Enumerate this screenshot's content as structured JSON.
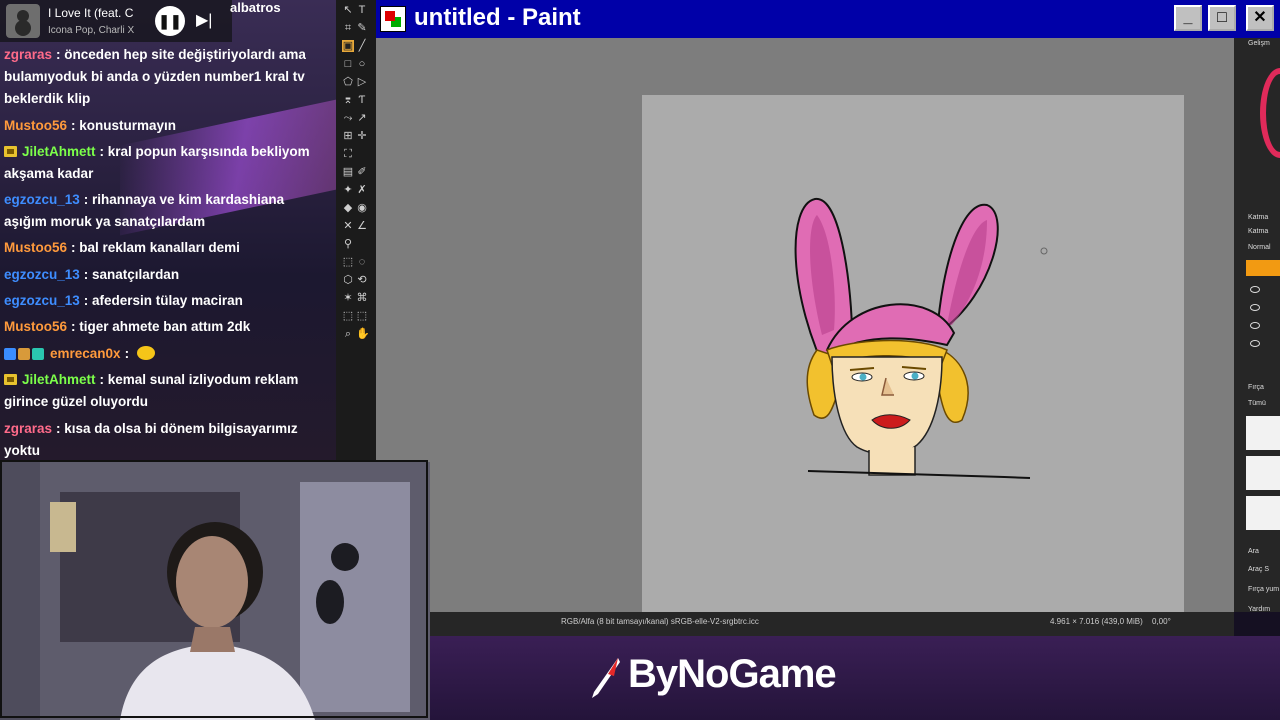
{
  "music": {
    "title": "I Love It (feat. C",
    "artist": "Icona Pop, Charli X",
    "pause_glyph": "❚❚",
    "next_glyph": "▶|"
  },
  "top_user": "albatros",
  "chat": [
    {
      "user": "zgraras",
      "color": "#ff6b8a",
      "text": ": önceden hep site değiştiriyolardı ama bulamıyoduk bi anda o yüzden number1 kral tv beklerdik klip"
    },
    {
      "user": "Mustoo56",
      "color": "#ff9a3c",
      "text": ": konusturmayın"
    },
    {
      "user": "JiletAhmett",
      "color": "#7cff4a",
      "badge": "crown",
      "text": ": kral popun karşısında bekliyom akşama kadar"
    },
    {
      "user": "egzozcu_13",
      "color": "#3e8dff",
      "text": ": rihannaya ve kim kardashiana aşığım moruk ya sanatçılardam"
    },
    {
      "user": "Mustoo56",
      "color": "#ff9a3c",
      "text": ": bal reklam kanalları demi"
    },
    {
      "user": "egzozcu_13",
      "color": "#3e8dff",
      "text": ": sanatçılardan"
    },
    {
      "user": "egzozcu_13",
      "color": "#3e8dff",
      "text": ": afedersin tülay maciran"
    },
    {
      "user": "Mustoo56",
      "color": "#ff9a3c",
      "text": ": tiger ahmete ban attım 2dk"
    },
    {
      "user": "emrecan0x",
      "color": "#ff9a3c",
      "badge": "multi",
      "text": ":"
    },
    {
      "user": "JiletAhmett",
      "color": "#7cff4a",
      "badge": "crown",
      "text": ": kemal sunal izliyodum reklam girince güzel oluyordu"
    },
    {
      "user": "zgraras",
      "color": "#ff6b8a",
      "text": ": kısa da olsa bi dönem bilgisayarımız yoktu"
    }
  ],
  "paint": {
    "title": "untitled - Paint",
    "min_glyph": "_",
    "max_glyph": "□",
    "close_glyph": "✕"
  },
  "right_panel": {
    "labels": [
      "Gelişm",
      "Katma",
      "Katma",
      "Normal",
      "Fırça",
      "Tümü",
      "Ara",
      "Araç S",
      "Fırça yum",
      "Yardım"
    ]
  },
  "status": {
    "color_info": "RGB/Alfa (8 bit tamsayı/kanal) sRGB-elle-V2-srgbtrc.icc",
    "dims": "4.961 × 7.016 (439,0 MiB)",
    "angle": "0,00°"
  },
  "brand": "ByNoGame",
  "colors": {
    "hat_pink": "#e06cb4",
    "hair_yellow": "#f2c12e",
    "skin": "#f6e0b8",
    "title_blue": "#0000a8"
  }
}
